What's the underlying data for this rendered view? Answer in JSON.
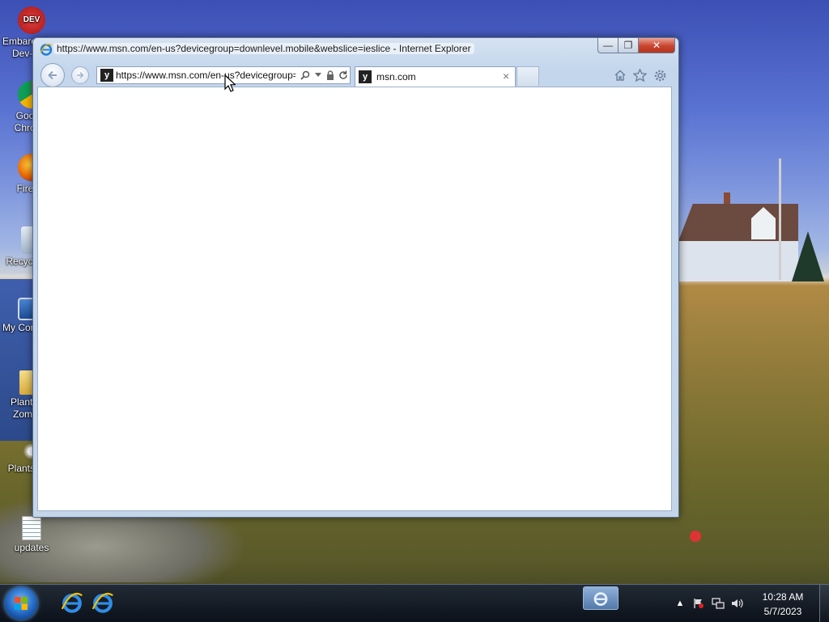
{
  "desktop": {
    "icons": [
      {
        "label_line1": "Embarcadero",
        "label_line2": "Dev-C++",
        "icon": "devcpp-icon"
      },
      {
        "label_line1": "Google",
        "label_line2": "Chrome",
        "icon": "chrome-icon"
      },
      {
        "label_line1": "Firefox",
        "label_line2": "",
        "icon": "firefox-icon"
      },
      {
        "label_line1": "Recycle Bin",
        "label_line2": "",
        "icon": "recycle-bin-icon"
      },
      {
        "label_line1": "My Computer",
        "label_line2": "",
        "icon": "computer-icon"
      },
      {
        "label_line1": "Plants vs.",
        "label_line2": "Zombies",
        "icon": "folder-icon"
      },
      {
        "label_line1": "Plants vs...",
        "label_line2": "",
        "icon": "pvz-icon"
      },
      {
        "label_line1": "updates",
        "label_line2": "",
        "icon": "text-file-icon"
      }
    ]
  },
  "ie": {
    "title": "https://www.msn.com/en-us?devicegroup=downlevel.mobile&webslice=ieslice - Internet Explorer",
    "address": "https://www.msn.com/en-us?devicegroup=downlevel.mobile&webslice=ieslice",
    "tab_title": "msn.com",
    "favicon_letter": "y",
    "buttons": {
      "minimize": "—",
      "maximize": "❐",
      "close": "✕"
    }
  },
  "taskbar": {
    "clock_time": "10:28 AM",
    "clock_date": "5/7/2023",
    "pinned": [
      "internet-explorer-icon",
      "internet-explorer-icon"
    ],
    "tray": [
      "show-hidden-icons",
      "action-center-flag-icon",
      "network-icon",
      "volume-icon"
    ]
  },
  "colors": {
    "ie_blue": "#1e7cd6",
    "close_red": "#c8442f",
    "taskbar": "#141b27"
  }
}
